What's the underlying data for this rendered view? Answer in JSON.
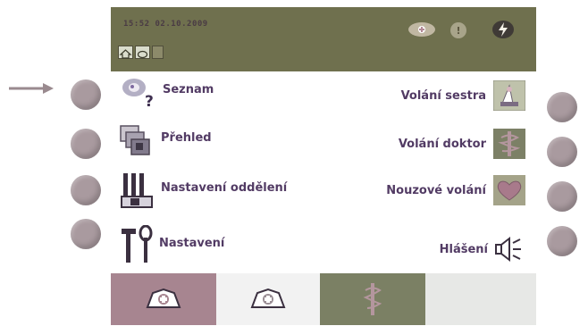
{
  "status_bar": {
    "datetime": "15:52 02.10.2009",
    "tabs": [
      "home",
      "active",
      "small"
    ]
  },
  "menu_left": [
    {
      "label": "Seznam",
      "icon": "help-icon"
    },
    {
      "label": "Přehled",
      "icon": "overview-icon"
    },
    {
      "label": "Nastavení oddělení",
      "icon": "ward-settings-icon"
    },
    {
      "label": "Nastavení",
      "icon": "tools-icon"
    }
  ],
  "menu_right": [
    {
      "label": "Volání sestra",
      "icon": "nurse-call-icon"
    },
    {
      "label": "Volání doktor",
      "icon": "doctor-call-icon"
    },
    {
      "label": "Nouzové volání",
      "icon": "heart-icon"
    },
    {
      "label": "Hlášení",
      "icon": "speaker-icon"
    }
  ],
  "bottom_nav": [
    "nurse-cap-icon",
    "nurse-cap-icon",
    "caduceus-icon",
    "empty"
  ],
  "colors": {
    "status_bar": "#6f704e",
    "hardware_button": "#a99a9f",
    "label_text": "#523b64",
    "nav_tab_1": "#a78590",
    "nav_tab_2": "#f2f2f2",
    "nav_tab_3": "#7b8064",
    "nav_tab_4": "#e7e8e6"
  }
}
